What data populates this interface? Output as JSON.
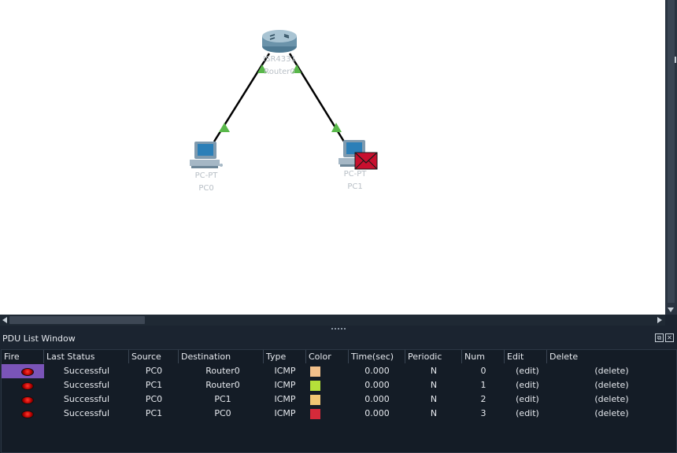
{
  "topology": {
    "router": {
      "model": "ISR4331",
      "name": "Router0"
    },
    "pc0": {
      "model": "PC-PT",
      "name": "PC0"
    },
    "pc1": {
      "model": "PC-PT",
      "name": "PC1"
    },
    "link_status_color": "#59b84a"
  },
  "pdu_window": {
    "title": "PDU List Window",
    "columns": [
      "Fire",
      "Last Status",
      "Source",
      "Destination",
      "Type",
      "Color",
      "Time(sec)",
      "Periodic",
      "Num",
      "Edit",
      "Delete"
    ],
    "rows": [
      {
        "status": "Successful",
        "source": "PC0",
        "destination": "Router0",
        "type": "ICMP",
        "color": "#f2c08a",
        "time": "0.000",
        "periodic": "N",
        "num": "0",
        "edit": "(edit)",
        "delete": "(delete)"
      },
      {
        "status": "Successful",
        "source": "PC1",
        "destination": "Router0",
        "type": "ICMP",
        "color": "#b5e03a",
        "time": "0.000",
        "periodic": "N",
        "num": "1",
        "edit": "(edit)",
        "delete": "(delete)"
      },
      {
        "status": "Successful",
        "source": "PC0",
        "destination": "PC1",
        "type": "ICMP",
        "color": "#f0c674",
        "time": "0.000",
        "periodic": "N",
        "num": "2",
        "edit": "(edit)",
        "delete": "(delete)"
      },
      {
        "status": "Successful",
        "source": "PC1",
        "destination": "PC0",
        "type": "ICMP",
        "color": "#d42a3a",
        "time": "0.000",
        "periodic": "N",
        "num": "3",
        "edit": "(edit)",
        "delete": "(delete)"
      }
    ]
  }
}
